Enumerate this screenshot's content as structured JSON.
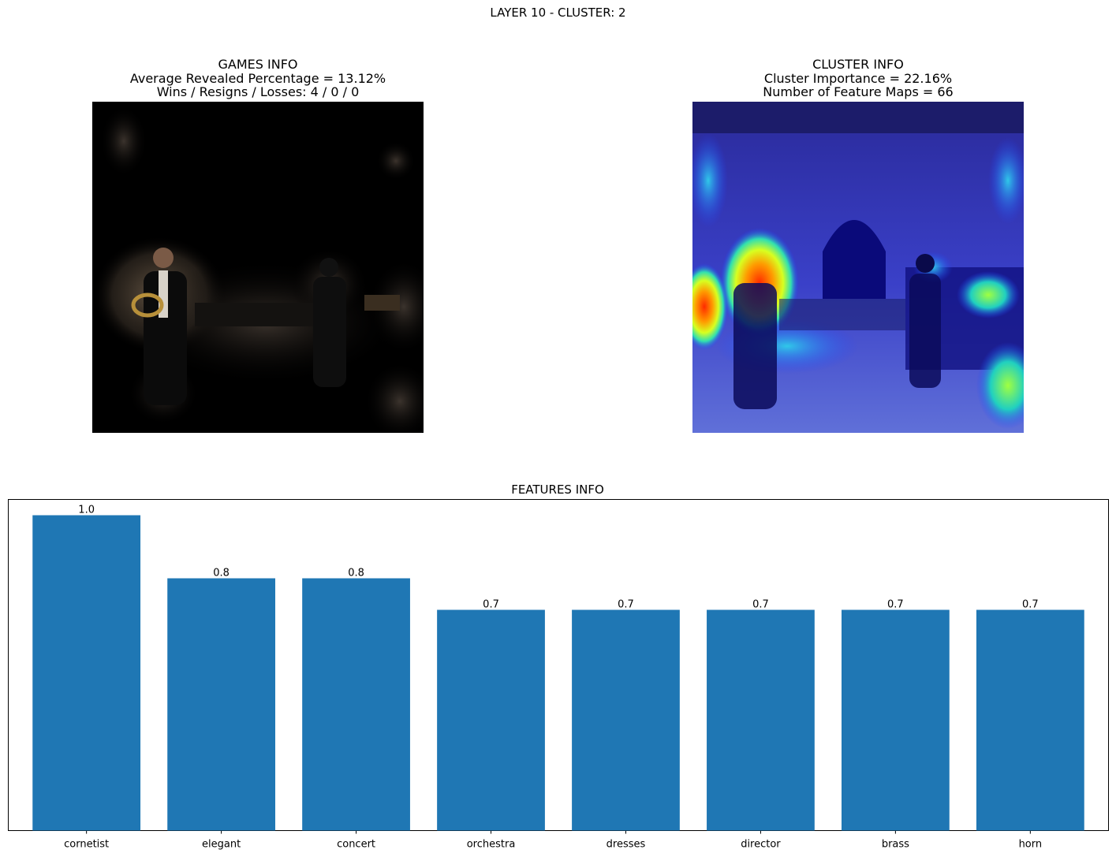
{
  "figure_title": "LAYER 10 - CLUSTER: 2",
  "games_panel": {
    "title_line1": "GAMES INFO",
    "title_line2": "Average Revealed Percentage = 13.12%",
    "title_line3": "Wins / Resigns / Losses: 4 / 0 / 0"
  },
  "cluster_panel": {
    "title_line1": "CLUSTER INFO",
    "title_line2": "Cluster Importance = 22.16%",
    "title_line3": "Number of Feature Maps = 66"
  },
  "chart_data": {
    "type": "bar",
    "title": "FEATURES INFO",
    "categories": [
      "cornetist",
      "elegant",
      "concert",
      "orchestra",
      "dresses",
      "director",
      "brass",
      "horn"
    ],
    "values": [
      1.0,
      0.8,
      0.8,
      0.7,
      0.7,
      0.7,
      0.7,
      0.7
    ],
    "value_labels": [
      "1.0",
      "0.8",
      "0.8",
      "0.7",
      "0.7",
      "0.7",
      "0.7",
      "0.7"
    ],
    "ylim": [
      0,
      1.05
    ],
    "bar_color": "#1f77b4",
    "xlabel": "",
    "ylabel": "",
    "grid": false
  }
}
